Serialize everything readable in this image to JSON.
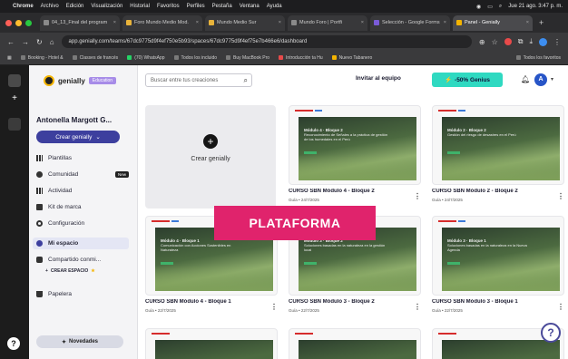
{
  "menubar": {
    "apple": "",
    "app": "Chrome",
    "items": [
      "Archivo",
      "Edición",
      "Visualización",
      "Historial",
      "Favoritos",
      "Perfiles",
      "Pestaña",
      "Ventana",
      "Ayuda"
    ],
    "clock": "Jue 21 ago. 3:47 p. m."
  },
  "browser": {
    "tabs": [
      {
        "label": "04_13_Final del program",
        "active": false
      },
      {
        "label": "Foro Mundo Medio Mod.",
        "active": false
      },
      {
        "label": "Mundo Medio Sur",
        "active": false
      },
      {
        "label": "Mundo Foro | Portfi",
        "active": false
      },
      {
        "label": "Selección - Google Forms",
        "active": false
      },
      {
        "label": "Panel - Genially",
        "active": true
      }
    ],
    "new_tab": "+",
    "url": "app.genially.com/teams/67dc9775d9f4ef750e5b93/spaces/67dc9775d9f4ef75e7b466e6/dashboard",
    "bookmarks": [
      "Booking - Hotel &",
      "Classes de francés",
      "(70) WhatsApp",
      "Todos los incluido",
      "Buy MacBook Pro",
      "Introducción ta Hu",
      "Nuevo Tabanero"
    ],
    "bookmarks_right": "Todos los favoritos"
  },
  "sidebar": {
    "brand": "genially",
    "edu_badge": "Education",
    "user_name": "Antonella Margott G...",
    "create_button": "Crear genially",
    "nav": [
      {
        "label": "Plantillas",
        "icon": "grid-icon"
      },
      {
        "label": "Comunidad",
        "icon": "community-icon",
        "badge": "New"
      },
      {
        "label": "Actividad",
        "icon": "activity-icon"
      },
      {
        "label": "Kit de marca",
        "icon": "brand-kit-icon"
      },
      {
        "label": "Configuración",
        "icon": "settings-icon"
      },
      {
        "label": "Mi espacio",
        "icon": "my-space-icon",
        "active": true
      },
      {
        "label": "Compartido conmi...",
        "icon": "shared-icon"
      }
    ],
    "create_space": "CREAR ESPACIO",
    "trash": "Papelera",
    "news_button": "Novedades"
  },
  "main": {
    "search_placeholder": "Buscar entre tus creaciones",
    "invite": "Invitar al equipo",
    "promo": "-50% Genius",
    "avatar_initial": "A",
    "new_card_label": "Crear genially",
    "cards": [
      {
        "title": "CURSO SBN Módulo 4 - Bloque 2",
        "meta": "Guía • 24/7/2025",
        "slide_title": "Módulo 4 · Bloque 2",
        "slide_text": "Reconocimiento de Señales a la práctica de gestión de los humedales en el Perú"
      },
      {
        "title": "CURSO SBN Módulo 2 - Bloque 2",
        "meta": "Guía • 24/7/2025",
        "slide_title": "Módulo 2 · Bloque 2",
        "slide_text": "Gestión del riesgo de desastres en el Perú"
      },
      {
        "title": "CURSO SBN Módulo 4 - Bloque 1",
        "meta": "Guía • 22/7/2025",
        "slide_title": "Módulo 4 · Bloque 1",
        "slide_text": "Comunicación con Acciones Sostenibles en Naturaleza"
      },
      {
        "title": "CURSO SBN Módulo 3 - Bloque 2",
        "meta": "Guía • 22/7/2025",
        "slide_title": "Módulo 3 · Bloque 2",
        "slide_text": "Soluciones basadas en la naturaleza en la gestión local"
      },
      {
        "title": "CURSO SBN Módulo 3 - Bloque 1",
        "meta": "Guía • 22/7/2025",
        "slide_title": "Módulo 3 · Bloque 1",
        "slide_text": "Soluciones basadas en la naturaleza en la Nueva Agenda"
      }
    ]
  },
  "overlay_label": "PLATAFORMA",
  "help_label": "?",
  "left_help": "?",
  "colors": {
    "primary": "#3d3f9e",
    "promo": "#2fd9c1",
    "overlay": "#e0236c",
    "avatar": "#2755c7"
  }
}
